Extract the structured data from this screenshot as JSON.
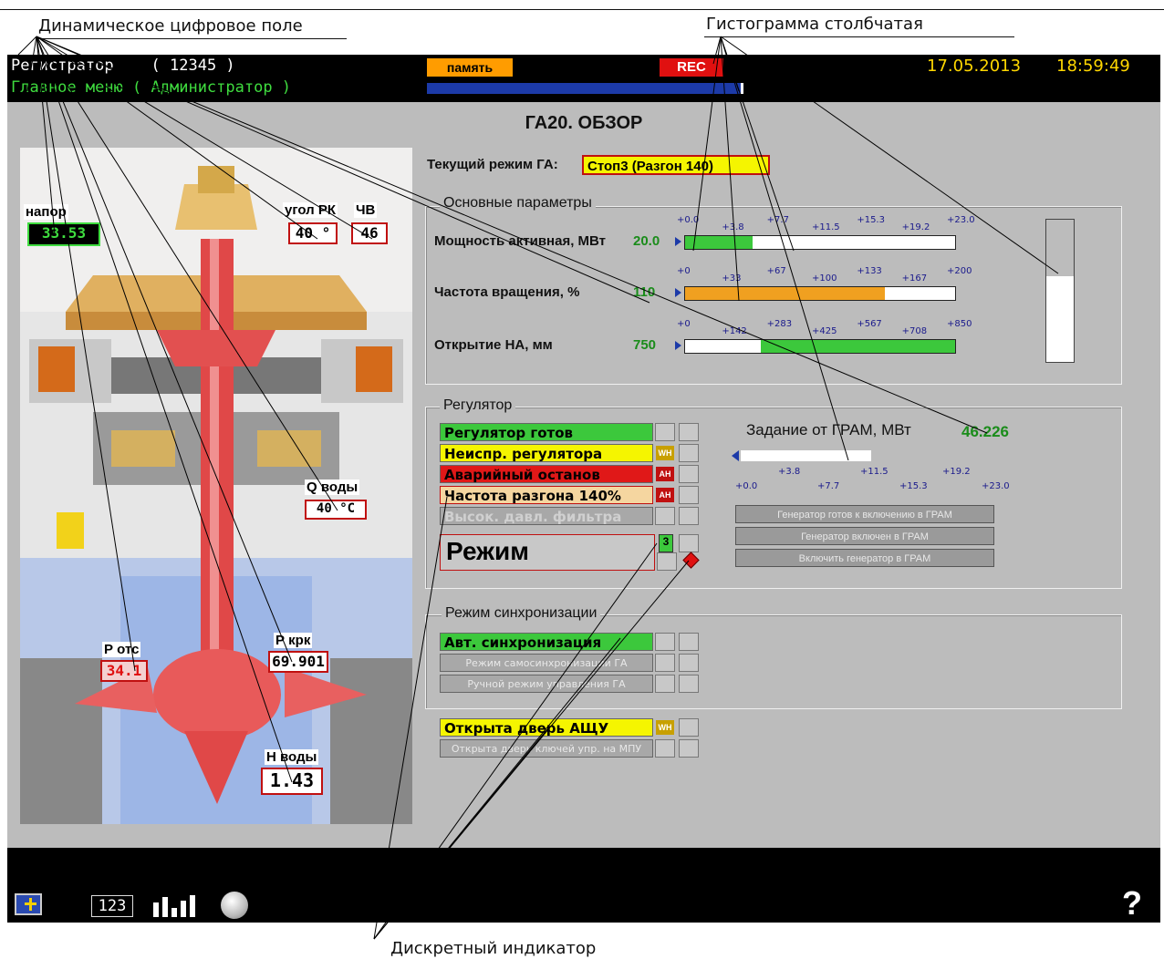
{
  "annotations": {
    "digital_field": "Динамическое цифровое поле",
    "histogram": "Гистограмма столбчатая",
    "discrete_indicator": "Дискретный индикатор"
  },
  "header": {
    "title": "Регистратор",
    "id": "( 12345 )",
    "subtitle": "Главное меню ( Администратор )",
    "memory_button": "память",
    "rec_label": "REC",
    "progress": 0.99,
    "date": "17.05.2013",
    "time": "18:59:49"
  },
  "page": {
    "title": "ГА20. ОБЗОР",
    "mode_label": "Текущий режим ГА:",
    "mode_value": "Стоп3 (Разгон 140)"
  },
  "machine": {
    "napor_label": "напор",
    "napor_value": "33.53",
    "ugol_label": "угол РК",
    "ugol_value": "40 °",
    "chv_label": "ЧВ",
    "chv_value": "46",
    "q_label": "Q воды",
    "q_value": "40 °С",
    "potc_label": "Р отс",
    "potc_value": "34.1",
    "pkrk_label": "Р крк",
    "pkrk_value": "69.901",
    "hvody_label": "Н воды",
    "hvody_value": "1.43"
  },
  "params": {
    "title": "Основные параметры",
    "rows": [
      {
        "label": "Мощность активная, МВт",
        "value": "20.0",
        "ticks_top": [
          "+0.0",
          "+7.7",
          "+15.3",
          "+23.0"
        ],
        "ticks_bottom": [
          "+3.8",
          "+11.5",
          "+19.2"
        ],
        "fill": 0.25
      },
      {
        "label": "Частота вращения, %",
        "value": "110",
        "ticks_top": [
          "+0",
          "+67",
          "+133",
          "+200"
        ],
        "ticks_bottom": [
          "+33",
          "+100",
          "+167"
        ],
        "fill": 0.74
      },
      {
        "label": "Открытие НА, мм",
        "value": "750",
        "ticks_top": [
          "+0",
          "+283",
          "+567",
          "+850"
        ],
        "ticks_bottom": [
          "+142",
          "+425",
          "+708"
        ],
        "fill": 0.72
      }
    ],
    "vertical_fill": 0.6
  },
  "regulator": {
    "title": "Регулятор",
    "indicators": [
      {
        "label": "Регулятор готов",
        "color": "#3cc83c",
        "badge": ""
      },
      {
        "label": "Неиспр. регулятора",
        "color": "#f5f500",
        "badge": "WH"
      },
      {
        "label": "Аварийный останов",
        "color": "#e01818",
        "badge": "AH"
      },
      {
        "label": "Частота разгона 140%",
        "color": "#f5d6a0",
        "badge": "AH"
      },
      {
        "label": "Высок. давл. фильтра",
        "color": "#a8a8a8",
        "badge": ""
      }
    ],
    "mode_label": "Режим",
    "mode_number": "3",
    "task_label": "Задание от ГРАМ, МВт",
    "task_value": "46.226",
    "task_ticks_top": [
      "+3.8",
      "+11.5",
      "+19.2"
    ],
    "task_ticks_bottom": [
      "+0.0",
      "+7.7",
      "+15.3",
      "+23.0"
    ],
    "task_fill": 0.53,
    "buttons": [
      "Генератор готов к включению в ГРАМ",
      "Генератор включен в ГРАМ",
      "Включить генератор в ГРАМ"
    ]
  },
  "sync": {
    "title": "Режим синхронизации",
    "items": [
      {
        "label": "Авт. синхронизация",
        "color": "#3cc83c"
      },
      {
        "label": "Режим самосинхронизации ГА",
        "color": "#a8a8a8"
      },
      {
        "label": "Ручной режим управления ГА",
        "color": "#a8a8a8"
      }
    ]
  },
  "doors": {
    "items": [
      {
        "label": "Открыта дверь АЩУ",
        "color": "#f5f500",
        "badge": "WH"
      },
      {
        "label": "Открыта дверь ключей упр. на МПУ",
        "color": "#a8a8a8",
        "badge": ""
      }
    ]
  },
  "footer": {
    "num_icon_label": "123",
    "help_label": "?"
  },
  "icons": [
    "screen-add-icon",
    "digits-icon",
    "bars-icon",
    "circle-icon",
    "help-icon"
  ]
}
